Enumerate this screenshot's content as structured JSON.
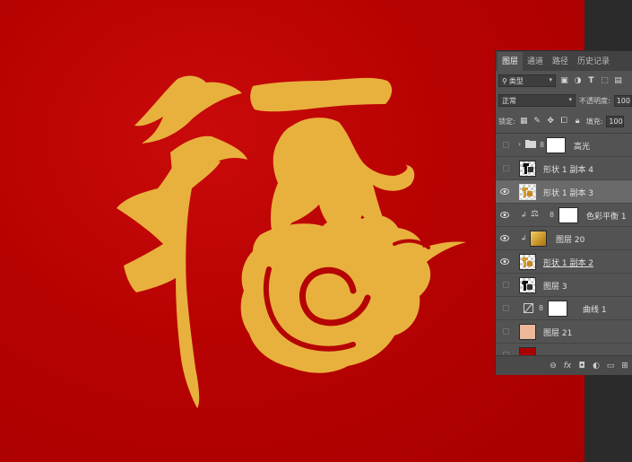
{
  "colors": {
    "canvas_red": "#b70202",
    "artwork_gold": "#e8b13d",
    "panel_bg": "#535353"
  },
  "tabs": [
    "图层",
    "通道",
    "路径",
    "历史记录"
  ],
  "filter": {
    "label": "类型",
    "icons": [
      "image-filter-icon",
      "adjustment-filter-icon",
      "type-filter-icon",
      "shape-filter-icon",
      "smart-object-filter-icon"
    ]
  },
  "blend": {
    "mode": "正常",
    "opacity_label": "不透明度:",
    "opacity_value": "100"
  },
  "lock": {
    "label": "锁定:",
    "fill_label": "填充:",
    "fill_value": "100"
  },
  "layers": [
    {
      "name": "高光",
      "kind": "group",
      "visible": false
    },
    {
      "name": "形状 1 副本 4",
      "kind": "shape",
      "visible": false
    },
    {
      "name": "形状 1 副本 3",
      "kind": "shape",
      "visible": true,
      "selected": true
    },
    {
      "name": "色彩平衡 1",
      "kind": "adjustment",
      "visible": true,
      "clipped": true
    },
    {
      "name": "图层 20",
      "kind": "gold",
      "visible": true,
      "clipped": true
    },
    {
      "name": "形状 1 副本 2",
      "kind": "shape",
      "visible": true,
      "underlined": true
    },
    {
      "name": "图层 3",
      "kind": "shape-plain",
      "visible": false
    },
    {
      "name": "曲线 1",
      "kind": "curves",
      "visible": false
    },
    {
      "name": "图层 21",
      "kind": "peach",
      "visible": false
    },
    {
      "name": "",
      "kind": "red",
      "visible": false
    }
  ],
  "bottom_icons": [
    "link-layers-icon",
    "fx-icon",
    "mask-icon",
    "adjustment-icon",
    "folder-icon",
    "new-layer-icon"
  ],
  "bottom_labels": [
    "⊖",
    "fx",
    "◘",
    "◐",
    "▭",
    "⊞"
  ]
}
